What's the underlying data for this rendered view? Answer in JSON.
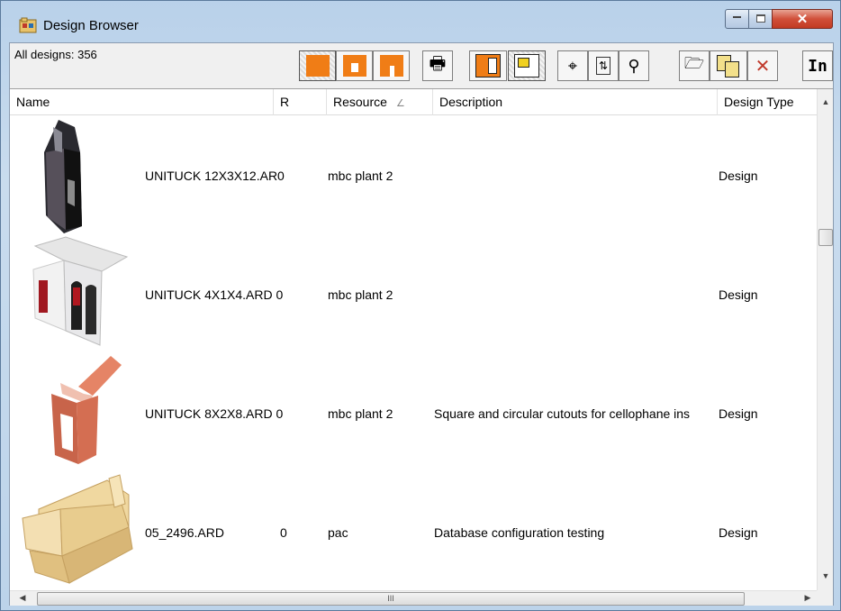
{
  "window": {
    "title": "Design Browser"
  },
  "toolbar": {
    "count_label": "All designs: 356",
    "text_button_label": "In",
    "icons": {
      "view_thumbnails": "thumbnails-view-icon",
      "view_large": "large-icons-view-icon",
      "view_list": "list-view-icon",
      "print": "printer-icon",
      "layout_a": "layout-view-icon",
      "layout_b": "detail-layout-icon",
      "find": "binoculars-icon",
      "refresh": "refresh-icon",
      "search": "magnifier-icon",
      "open": "open-folder-icon",
      "copy": "copy-design-icon",
      "delete": "delete-icon"
    }
  },
  "columns": [
    {
      "label": "Name"
    },
    {
      "label": "R"
    },
    {
      "label": "Resource",
      "sort_glyph": "∠"
    },
    {
      "label": "Description"
    },
    {
      "label": "Design Type"
    }
  ],
  "rows": [
    {
      "name": "UNITUCK 12X3X12.AR0",
      "r": "",
      "resource": "mbc plant 2",
      "description": "",
      "type": "Design"
    },
    {
      "name": "UNITUCK 4X1X4.ARD 0",
      "r": "",
      "resource": "mbc plant 2",
      "description": "",
      "type": "Design"
    },
    {
      "name": "UNITUCK 8X2X8.ARD 0",
      "r": "",
      "resource": "mbc plant 2",
      "description": "Square and circular cutouts for cellophane ins",
      "type": "Design"
    },
    {
      "name": "05_2496.ARD",
      "r": "0",
      "resource": "pac",
      "description": "Database configuration testing",
      "type": "Design"
    }
  ],
  "scrollbar": {
    "h_grip": "III"
  },
  "colors": {
    "accent_orange": "#f07d16",
    "close_red": "#c23a22"
  }
}
